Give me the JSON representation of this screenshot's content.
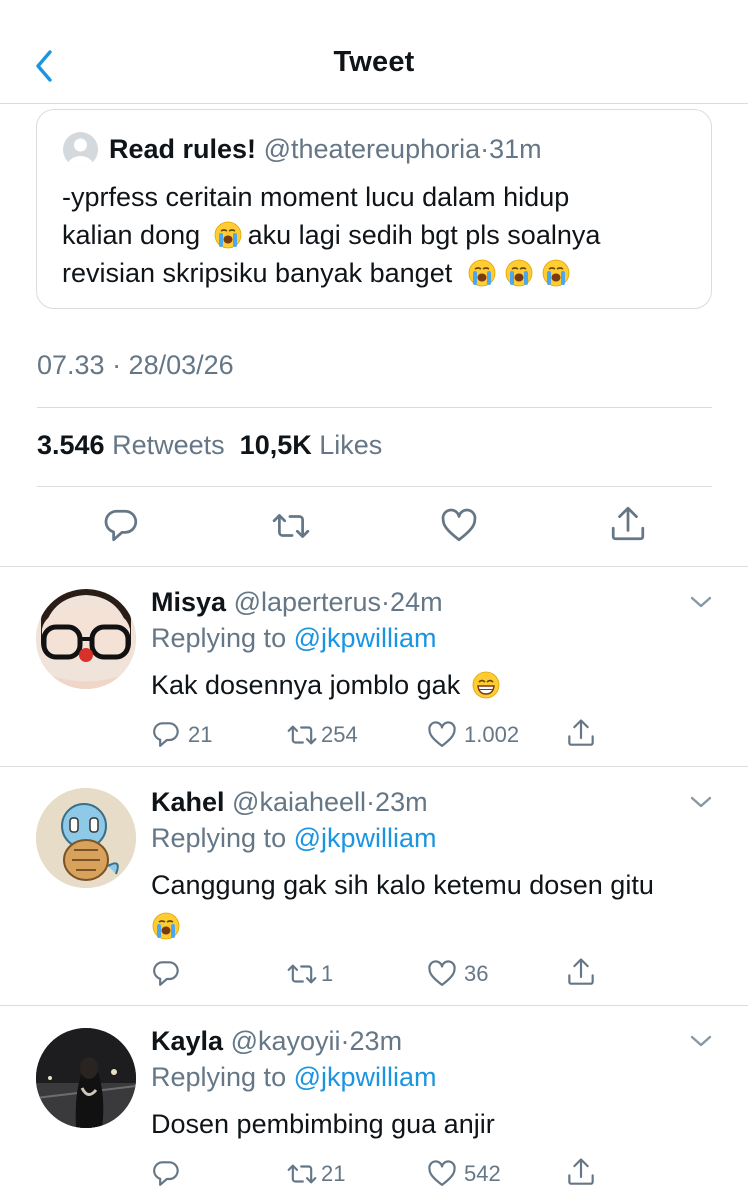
{
  "header": {
    "title": "Tweet",
    "back_icon": "chevron-left-icon"
  },
  "colors": {
    "accent": "#1b95e0",
    "secondary_text": "#657786",
    "divider": "#d9dde0"
  },
  "quoted_tweet": {
    "name": "Read rules!",
    "handle": "@theatereuphoria",
    "separator": "·",
    "time": "31m",
    "text_line1": "-yprfess ceritain moment lucu dalam hidup",
    "text_line2a": "kalian dong",
    "text_line2b": "aku lagi sedih bgt pls soalnya",
    "text_line3": "revisian skripsiku banyak banget",
    "emoji": "loudly-crying-face"
  },
  "tweet_meta": {
    "timestamp": "07.33 · 28/03/26"
  },
  "stats": {
    "retweets_count": "3.546",
    "retweets_label": "Retweets",
    "likes_count": "10,5K",
    "likes_label": "Likes"
  },
  "actions": [
    "reply-icon",
    "retweet-icon",
    "like-icon",
    "share-icon"
  ],
  "replies": [
    {
      "name": "Misya",
      "handle": "@laperterus",
      "separator": "·",
      "time": "24m",
      "replying_prefix": "Replying to",
      "replying_handle": "@jkpwilliam",
      "text": "Kak dosennya jomblo gak",
      "emoji": "grinning-face",
      "reply_count": "21",
      "retweet_count": "254",
      "like_count": "1.002"
    },
    {
      "name": "Kahel",
      "handle": "@kaiaheell",
      "separator": "·",
      "time": "23m",
      "replying_prefix": "Replying to",
      "replying_handle": "@jkpwilliam",
      "text": "Canggung gak sih kalo ketemu dosen gitu",
      "emoji": "loudly-crying-face",
      "reply_count": "",
      "retweet_count": "1",
      "like_count": "36"
    },
    {
      "name": "Kayla",
      "handle": "@kayoyii",
      "separator": "·",
      "time": "23m",
      "replying_prefix": "Replying to",
      "replying_handle": "@jkpwilliam",
      "text": "Dosen pembimbing gua anjir",
      "emoji": "",
      "reply_count": "",
      "retweet_count": "21",
      "like_count": "542"
    }
  ]
}
